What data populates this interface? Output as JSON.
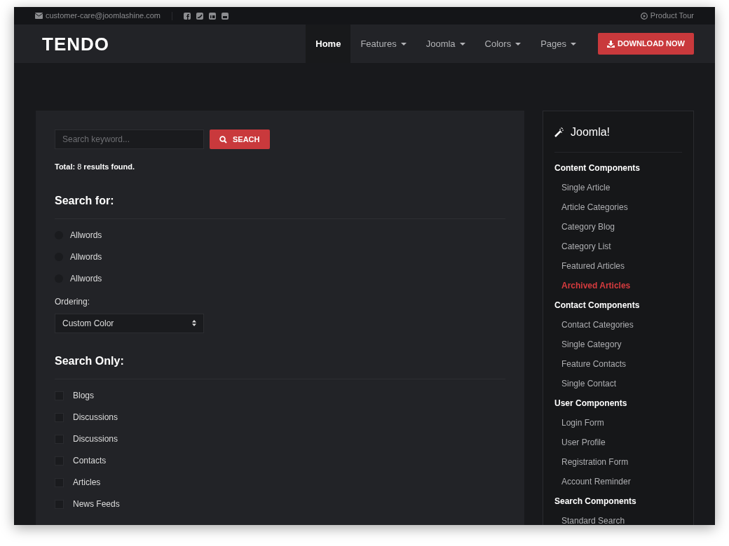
{
  "topbar": {
    "email": "customer-care@joomlashine.com",
    "product_tour": "Product Tour"
  },
  "navbar": {
    "logo": "TENDO",
    "items": [
      {
        "label": "Home",
        "selected": true,
        "dropdown": false
      },
      {
        "label": "Features",
        "selected": false,
        "dropdown": true
      },
      {
        "label": "Joomla",
        "selected": false,
        "dropdown": true
      },
      {
        "label": "Colors",
        "selected": false,
        "dropdown": true
      },
      {
        "label": "Pages",
        "selected": false,
        "dropdown": true
      }
    ],
    "download_button": "DOWNLOAD NOW"
  },
  "search": {
    "placeholder": "Search keyword...",
    "button": "SEACH",
    "total": "**Total:** 8 **results found.**"
  },
  "search_for": {
    "heading": "Search for:",
    "options": [
      {
        "label": "Allwords",
        "selected": false
      },
      {
        "label": "Allwords",
        "selected": false
      },
      {
        "label": "Allwords",
        "selected": false
      }
    ]
  },
  "ordering": {
    "label": "Ordering:",
    "value": "Custom Color"
  },
  "search_only": {
    "heading": "Search Only:",
    "options": [
      {
        "label": "Blogs",
        "checked": false
      },
      {
        "label": "Discussions",
        "checked": false
      },
      {
        "label": "Discussions",
        "checked": false
      },
      {
        "label": "Contacts",
        "checked": false
      },
      {
        "label": "Articles",
        "checked": false
      },
      {
        "label": "News Feeds",
        "checked": false
      }
    ]
  },
  "sidebar": {
    "title": "Joomla!",
    "groups": [
      {
        "label": "Content Components",
        "children": [
          {
            "label": "Single Article",
            "selected": false
          },
          {
            "label": "Article Categories",
            "selected": false
          },
          {
            "label": "Category Blog",
            "selected": false
          },
          {
            "label": "Category List",
            "selected": false
          },
          {
            "label": "Featured Articles",
            "selected": false
          },
          {
            "label": "Archived Articles",
            "selected": true
          }
        ]
      },
      {
        "label": "Contact Components",
        "children": [
          {
            "label": "Contact Categories",
            "selected": false
          },
          {
            "label": "Single Category",
            "selected": false
          },
          {
            "label": "Feature Contacts",
            "selected": false
          },
          {
            "label": "Single Contact",
            "selected": false
          }
        ]
      },
      {
        "label": "User Components",
        "children": [
          {
            "label": "Login Form",
            "selected": false
          },
          {
            "label": "User Profile",
            "selected": false
          },
          {
            "label": "Registration Form",
            "selected": false
          },
          {
            "label": "Account Reminder",
            "selected": false
          }
        ]
      },
      {
        "label": "Search Components",
        "children": [
          {
            "label": "Standard Search",
            "selected": false
          }
        ]
      }
    ]
  }
}
